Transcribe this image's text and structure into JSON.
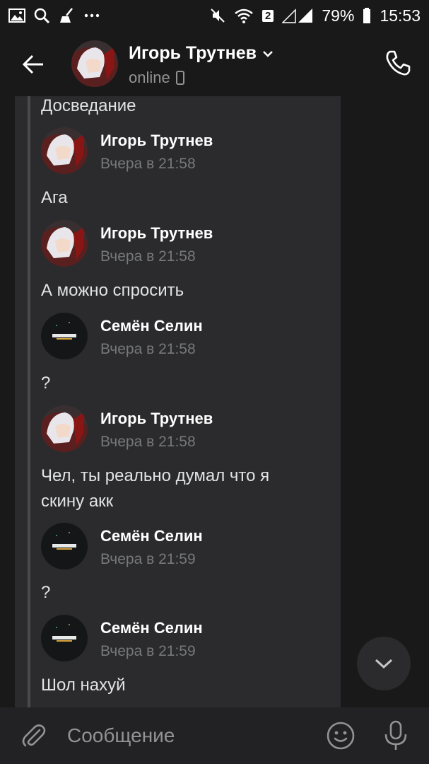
{
  "status_bar": {
    "icons_left": [
      "gallery-icon",
      "search-icon",
      "broom-icon",
      "more-dots-icon"
    ],
    "icons_right": [
      "mute-icon",
      "wifi-icon",
      "signal-icon",
      "battery-icon"
    ],
    "sim_badge": "2",
    "battery": "79%",
    "time": "15:53"
  },
  "header": {
    "contact_name": "Игорь Трутнев",
    "status": "online",
    "avatar": "anime-avatar"
  },
  "forwarded": {
    "items": [
      {
        "kind": "text",
        "text": "Досведание"
      },
      {
        "kind": "sender",
        "name": "Игорь Трутнев",
        "time": "Вчера в 21:58",
        "avatar": "anime-avatar"
      },
      {
        "kind": "text",
        "text": "Ага"
      },
      {
        "kind": "sender",
        "name": "Игорь Трутнев",
        "time": "Вчера в 21:58",
        "avatar": "anime-avatar"
      },
      {
        "kind": "text",
        "text": "А можно спросить"
      },
      {
        "kind": "sender",
        "name": "Семён Селин",
        "time": "Вчера в 21:58",
        "avatar": "standoff-avatar"
      },
      {
        "kind": "text",
        "text": "?"
      },
      {
        "kind": "sender",
        "name": "Игорь Трутнев",
        "time": "Вчера в 21:58",
        "avatar": "anime-avatar"
      },
      {
        "kind": "text",
        "text": "Чел, ты реально думал что я\nскину акк"
      },
      {
        "kind": "sender",
        "name": "Семён Селин",
        "time": "Вчера в 21:59",
        "avatar": "standoff-avatar"
      },
      {
        "kind": "text",
        "text": "?"
      },
      {
        "kind": "sender",
        "name": "Семён Селин",
        "time": "Вчера в 21:59",
        "avatar": "standoff-avatar"
      },
      {
        "kind": "text",
        "text": "Шол нахуй"
      }
    ]
  },
  "composer": {
    "placeholder": "Сообщение"
  },
  "colors": {
    "background": "#19191a",
    "panel": "#2b2b2d",
    "text": "#e1e3e6",
    "secondary": "#76787a"
  }
}
